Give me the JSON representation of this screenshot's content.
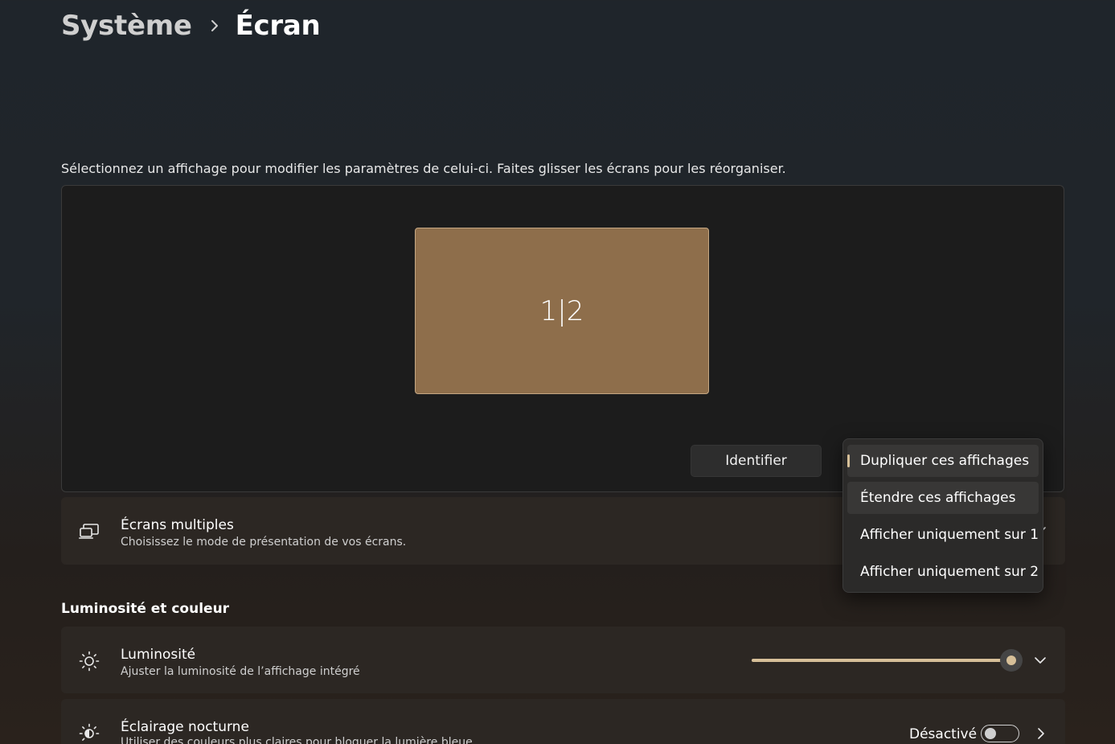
{
  "breadcrumb": {
    "parent": "Système",
    "current": "Écran"
  },
  "instructions": "Sélectionnez un affichage pour modifier les paramètres de celui-ci. Faites glisser les écrans pour les réorganiser.",
  "arrangement": {
    "monitor_label": "1|2",
    "identify_label": "Identifier"
  },
  "multiple_displays": {
    "title": "Écrans multiples",
    "subtitle": "Choisissez le mode de présentation de vos écrans.",
    "icon": "multiple-displays-icon"
  },
  "dropdown": {
    "options": [
      {
        "label": "Dupliquer ces affichages",
        "selected": true
      },
      {
        "label": "Étendre ces affichages",
        "selected": false,
        "hover": true
      },
      {
        "label": "Afficher uniquement sur 1",
        "selected": false
      },
      {
        "label": "Afficher uniquement sur 2",
        "selected": false
      }
    ]
  },
  "brightness_section": {
    "heading": "Luminosité et couleur",
    "brightness": {
      "title": "Luminosité",
      "subtitle": "Ajuster la luminosité de l’affichage intégré",
      "icon": "sun-icon",
      "level_fraction": 1.0
    },
    "night_light": {
      "title": "Éclairage nocturne",
      "subtitle": "Utiliser des couleurs plus claires pour bloquer la lumière bleue",
      "icon": "night-light-icon",
      "state_label": "Désactivé",
      "enabled": false
    }
  },
  "colors": {
    "accent": "#d6bf98",
    "monitor_fill": "#8e6e4b",
    "card_bg": "#2c2723"
  }
}
